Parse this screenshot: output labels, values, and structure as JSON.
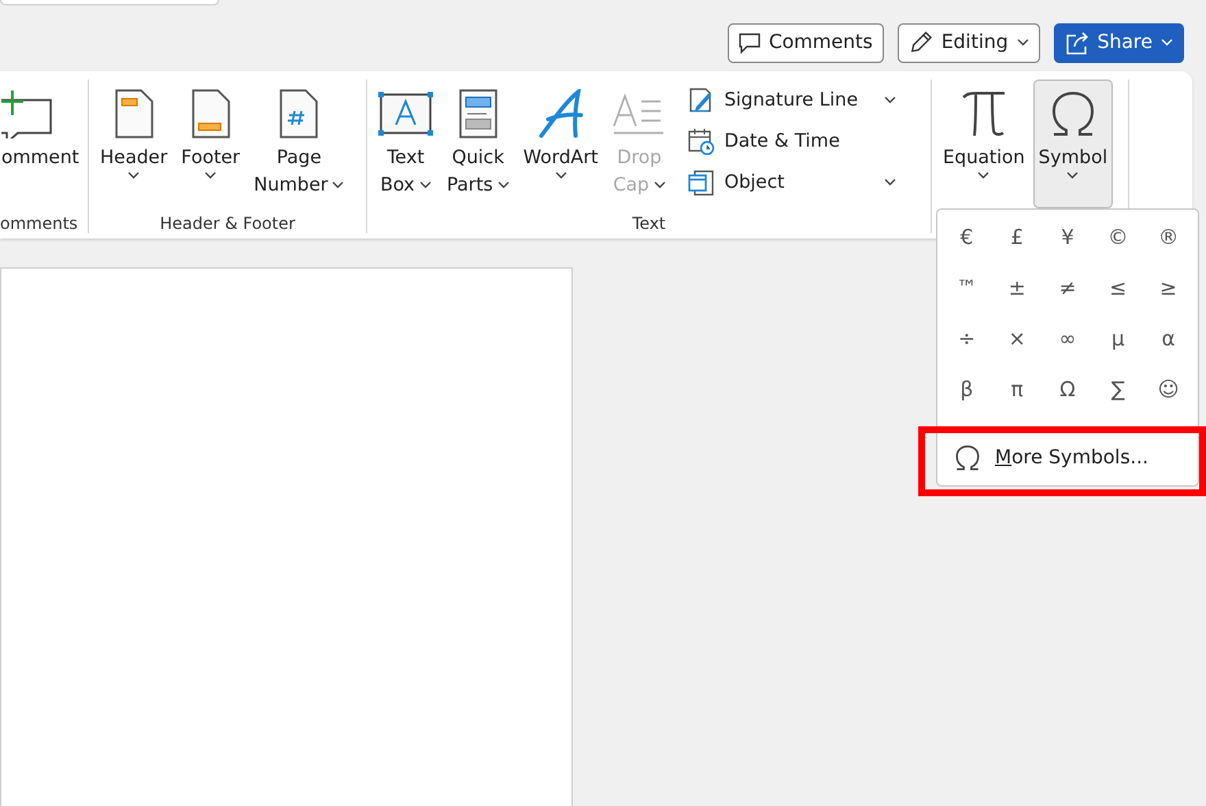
{
  "top_bar": {
    "buttons": [
      {
        "kind": "comments",
        "label": "Comments"
      },
      {
        "kind": "editing",
        "label": "Editing"
      },
      {
        "kind": "share",
        "label": "Share"
      }
    ]
  },
  "ribbon": {
    "groups": [
      {
        "label": "omments",
        "large": [
          {
            "lines": [
              "omment"
            ],
            "caret": false
          }
        ]
      },
      {
        "label": "Header & Footer",
        "large": [
          {
            "lines": [
              "Header"
            ],
            "caret": true
          },
          {
            "lines": [
              "Footer"
            ],
            "caret": true
          },
          {
            "lines": [
              "Page",
              "Number"
            ],
            "caret": true
          }
        ]
      },
      {
        "label": "Text",
        "large": [
          {
            "lines": [
              "Text",
              "Box"
            ],
            "caret": true,
            "disabled": false
          },
          {
            "lines": [
              "Quick",
              "Parts"
            ],
            "caret": true,
            "disabled": false
          },
          {
            "lines": [
              "WordArt"
            ],
            "caret": true,
            "disabled": false
          },
          {
            "lines": [
              "Drop",
              "Cap"
            ],
            "caret": true,
            "disabled": true
          }
        ],
        "small": [
          {
            "label": "Signature Line",
            "caret": true
          },
          {
            "label": "Date & Time",
            "caret": false
          },
          {
            "label": "Object",
            "caret": true
          }
        ]
      },
      {
        "large": [
          {
            "lines": [
              "Equation"
            ],
            "caret": true,
            "selected": false
          },
          {
            "lines": [
              "Symbol"
            ],
            "caret": true,
            "selected": true
          }
        ]
      }
    ]
  },
  "symbol_menu": {
    "symbols": [
      "€",
      "£",
      "¥",
      "©",
      "®",
      "™",
      "±",
      "≠",
      "≤",
      "≥",
      "÷",
      "×",
      "∞",
      "µ",
      "α",
      "β",
      "π",
      "Ω",
      "∑",
      "☺"
    ],
    "more": {
      "label": "More Symbols...",
      "highlighted": true
    }
  }
}
